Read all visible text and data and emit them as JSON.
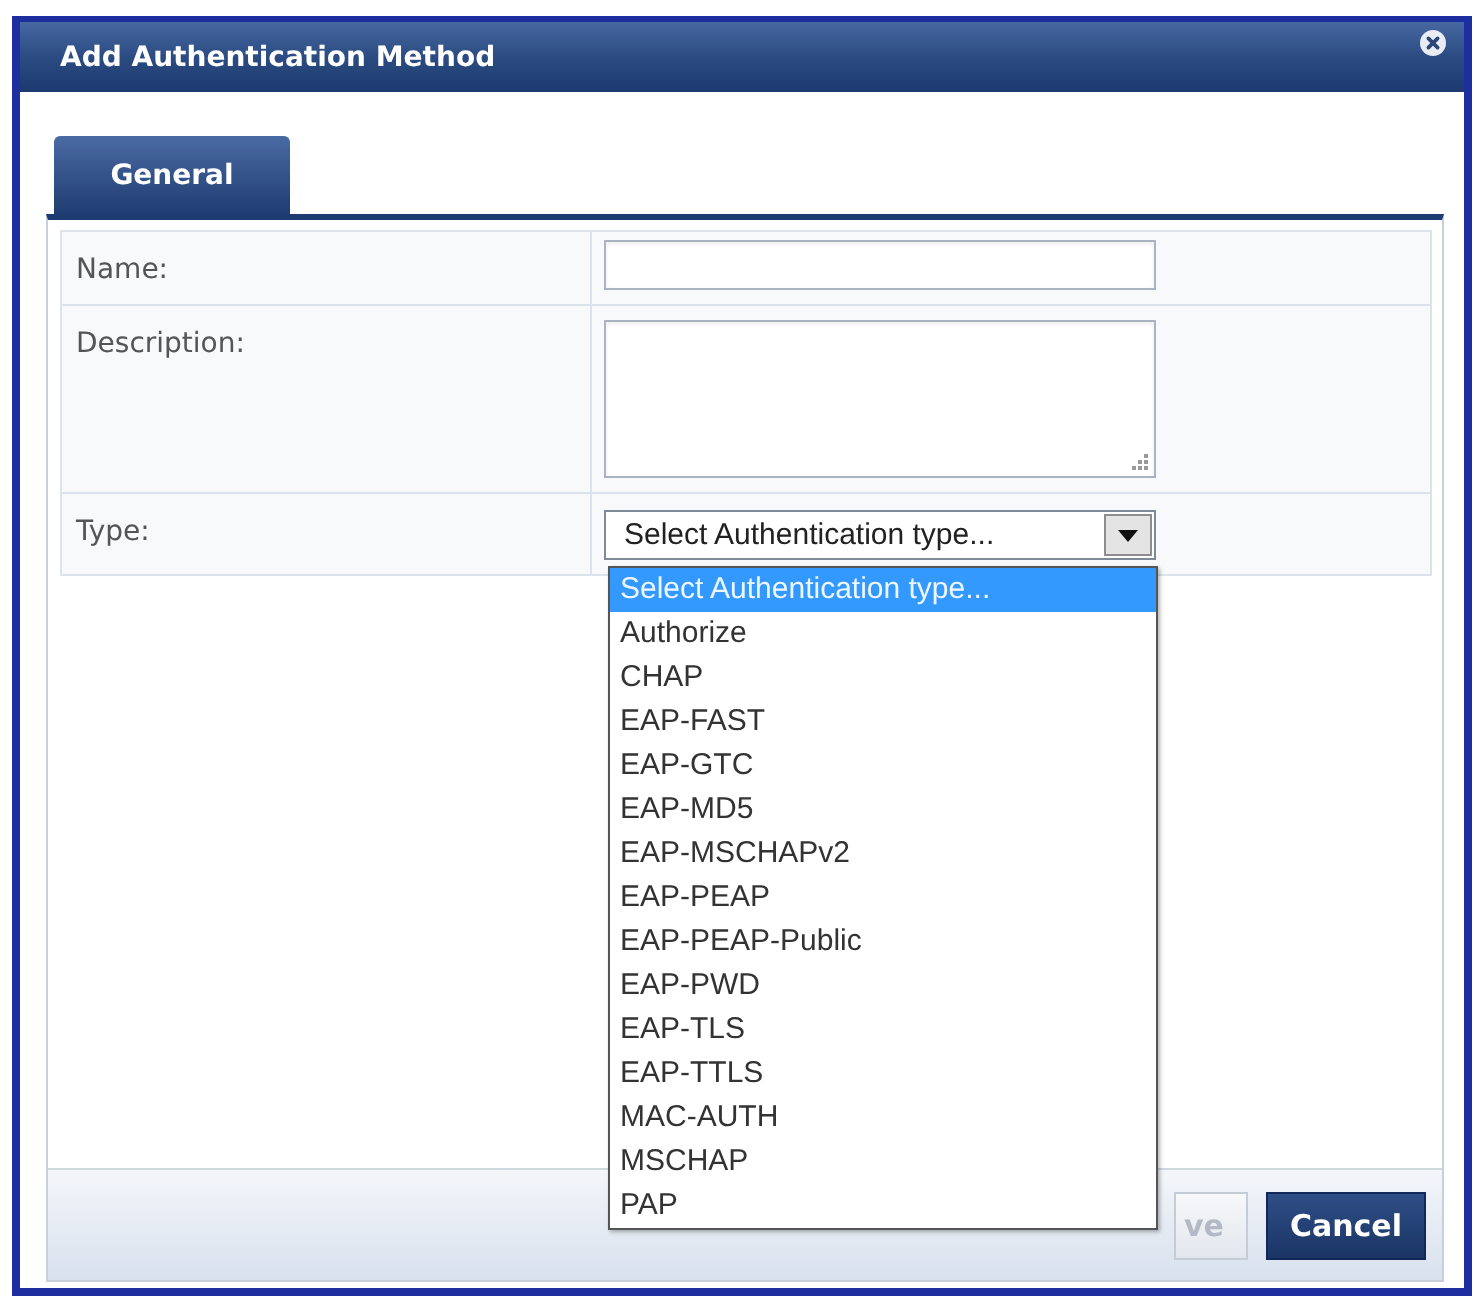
{
  "window": {
    "title": "Add Authentication Method"
  },
  "tabs": [
    {
      "label": "General",
      "selected": true
    }
  ],
  "form": {
    "fields": [
      {
        "kind": "text",
        "label": "Name:"
      },
      {
        "kind": "textarea",
        "label": "Description:"
      },
      {
        "kind": "select",
        "label": "Type:",
        "value": "Select Authentication type...",
        "expanded": true,
        "options": [
          {
            "label": "Select Authentication type...",
            "selected": true
          },
          {
            "label": "Authorize",
            "selected": false
          },
          {
            "label": "CHAP",
            "selected": false
          },
          {
            "label": "EAP-FAST",
            "selected": false
          },
          {
            "label": "EAP-GTC",
            "selected": false
          },
          {
            "label": "EAP-MD5",
            "selected": false
          },
          {
            "label": "EAP-MSCHAPv2",
            "selected": false
          },
          {
            "label": "EAP-PEAP",
            "selected": false
          },
          {
            "label": "EAP-PEAP-Public",
            "selected": false
          },
          {
            "label": "EAP-PWD",
            "selected": false
          },
          {
            "label": "EAP-TLS",
            "selected": false
          },
          {
            "label": "EAP-TTLS",
            "selected": false
          },
          {
            "label": "MAC-AUTH",
            "selected": false
          },
          {
            "label": "MSCHAP",
            "selected": false
          },
          {
            "label": "PAP",
            "selected": false
          }
        ]
      }
    ]
  },
  "buttons": [
    {
      "label": "ve",
      "disabled": true
    },
    {
      "label": "Cancel",
      "disabled": false
    }
  ]
}
